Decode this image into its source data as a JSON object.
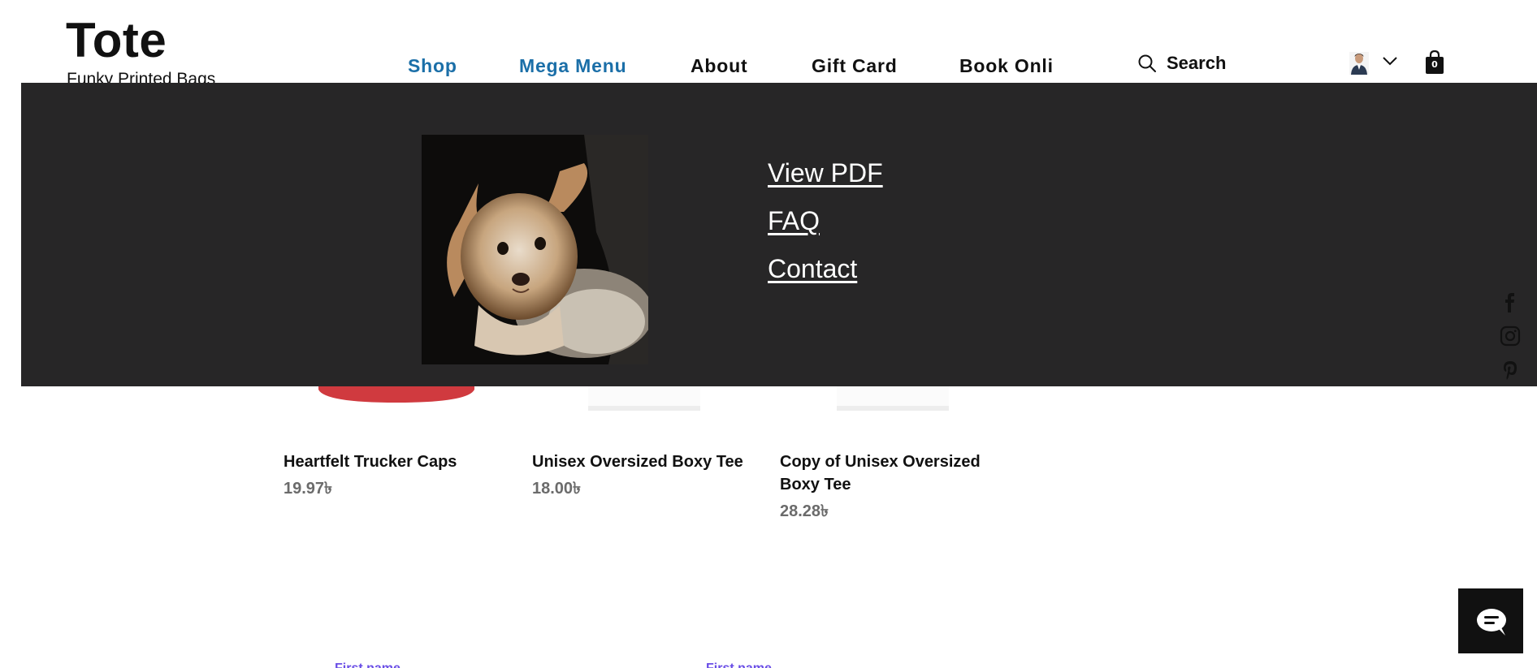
{
  "header": {
    "logo": "Tote",
    "tagline": "Funky Printed Bags",
    "nav": [
      {
        "label": "Shop"
      },
      {
        "label": "Mega Menu"
      },
      {
        "label": "About"
      },
      {
        "label": "Gift Card"
      },
      {
        "label": "Book Onli"
      }
    ],
    "search_label": "Search",
    "cart_count": "0"
  },
  "mega_menu": {
    "links": [
      {
        "label": "View PDF"
      },
      {
        "label": "FAQ"
      },
      {
        "label": "Contact"
      }
    ]
  },
  "products": [
    {
      "name": "Heartfelt Trucker Caps",
      "price": "19.97৳"
    },
    {
      "name": "Unisex Oversized Boxy Tee",
      "price": "18.00৳"
    },
    {
      "name": "Copy of Unisex Oversized Boxy Tee",
      "price": "28.28৳"
    }
  ],
  "form": {
    "labels": [
      "First name",
      "First name"
    ]
  },
  "colors": {
    "nav_active": "#1b6fa8",
    "mega_bg": "#272627",
    "price": "#6b6b6b"
  }
}
